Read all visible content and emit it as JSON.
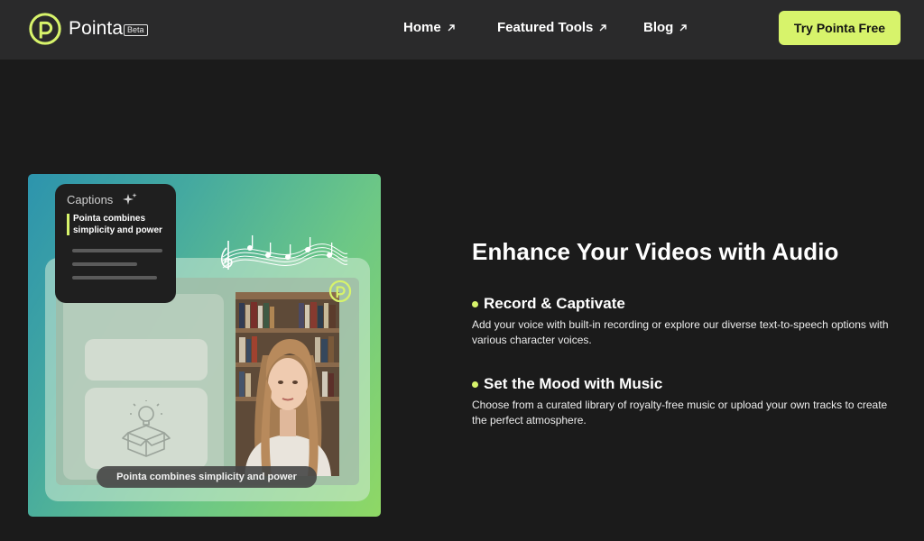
{
  "header": {
    "brand": "Pointa",
    "beta": "Beta",
    "nav": [
      {
        "label": "Home"
      },
      {
        "label": "Featured Tools"
      },
      {
        "label": "Blog"
      }
    ],
    "cta_label": "Try Pointa Free"
  },
  "illustration": {
    "captions_title": "Captions",
    "captions_text": "Pointa combines simplicity and power",
    "subtitle": "Pointa combines simplicity and power"
  },
  "content": {
    "headline": "Enhance Your Videos with Audio",
    "features": [
      {
        "title": "Record & Captivate",
        "desc": "Add your voice with built-in recording or explore our diverse text-to-speech options with various character voices."
      },
      {
        "title": "Set the Mood with Music",
        "desc": "Choose from a curated library of royalty-free music or upload your own tracks to create the perfect atmosphere."
      }
    ]
  },
  "colors": {
    "accent": "#d7f36b",
    "background": "#1b1b1b",
    "header": "#2a2a2b"
  }
}
